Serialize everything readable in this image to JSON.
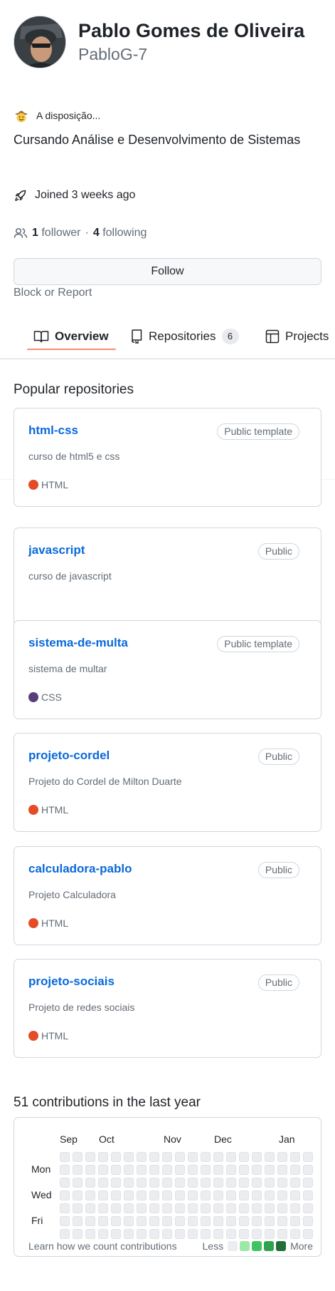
{
  "profile": {
    "name": "Pablo Gomes de Oliveira",
    "login": "PabloG-7",
    "status": {
      "emoji_icon": "cowboy-emoji-icon",
      "text": "A disposição..."
    },
    "bio": "Cursando Análise e Desenvolvimento de Sistemas",
    "joined": "Joined 3 weeks ago",
    "followers_count": "1",
    "followers_label": "follower",
    "separator": "·",
    "following_count": "4",
    "following_label": "following",
    "follow_button": "Follow",
    "block_report": "Block or Report"
  },
  "tabs": [
    {
      "label": "Overview",
      "icon": "book-icon",
      "active": true
    },
    {
      "label": "Repositories",
      "icon": "repo-icon",
      "count": "6"
    },
    {
      "label": "Projects",
      "icon": "table-icon"
    }
  ],
  "popular": {
    "title": "Popular repositories",
    "repos": [
      {
        "name": "html-css",
        "visibility": "Public template",
        "description": "curso de html5 e css",
        "language": "HTML",
        "language_color": "#e34c26"
      },
      {
        "name": "javascript",
        "visibility": "Public",
        "description": "curso de javascript",
        "language": "",
        "language_color": ""
      },
      {
        "name": "sistema-de-multa",
        "visibility": "Public template",
        "description": "sistema de multar",
        "language": "CSS",
        "language_color": "#563d7c"
      },
      {
        "name": "projeto-cordel",
        "visibility": "Public",
        "description": "Projeto do Cordel de Milton Duarte",
        "language": "HTML",
        "language_color": "#e34c26"
      },
      {
        "name": "calculadora-pablo",
        "visibility": "Public",
        "description": "Projeto Calculadora",
        "language": "HTML",
        "language_color": "#e34c26"
      },
      {
        "name": "projeto-sociais",
        "visibility": "Public",
        "description": "Projeto de redes sociais",
        "language": "HTML",
        "language_color": "#e34c26"
      }
    ]
  },
  "contributions": {
    "title": "51 contributions in the last year",
    "months": [
      "Sep",
      "Oct",
      "Nov",
      "Dec",
      "Jan"
    ],
    "days": [
      "Mon",
      "Wed",
      "Fri"
    ],
    "learn_text": "Learn how we count contributions",
    "less": "Less",
    "more": "More",
    "legend_colors": [
      "#ebedf0",
      "#9be9a8",
      "#40c463",
      "#30a14e",
      "#216e39"
    ]
  }
}
